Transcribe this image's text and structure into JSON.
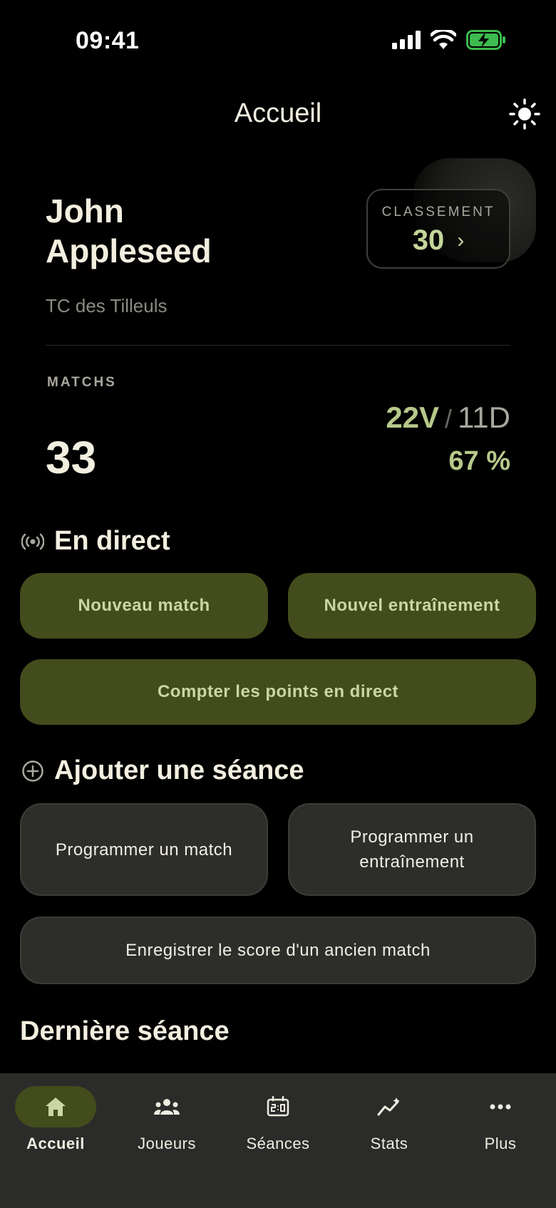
{
  "status_bar": {
    "time": "09:41"
  },
  "nav": {
    "title": "Accueil"
  },
  "profile": {
    "first_name": "John",
    "last_name": "Appleseed",
    "club": "TC des Tilleuls",
    "ranking_label": "CLASSEMENT",
    "ranking_value": "30",
    "ranking_chevron": "›"
  },
  "matches": {
    "label": "MATCHS",
    "count": "33",
    "wins": "22V",
    "separator": "/",
    "losses": "11D",
    "win_pct": "67 %"
  },
  "live": {
    "title": "En direct",
    "new_match": "Nouveau match",
    "new_training": "Nouvel entraînement",
    "live_score": "Compter les points en direct"
  },
  "add_session": {
    "title": "Ajouter une séance",
    "schedule_match": "Programmer un match",
    "schedule_training": "Programmer un entraînement",
    "record_old": "Enregistrer le score d'un ancien match"
  },
  "last_session": {
    "title": "Dernière séance"
  },
  "tabs": [
    {
      "label": "Accueil",
      "icon": "home-icon",
      "active": true
    },
    {
      "label": "Joueurs",
      "icon": "players-icon",
      "active": false
    },
    {
      "label": "Séances",
      "icon": "scoreboard-icon",
      "active": false
    },
    {
      "label": "Stats",
      "icon": "stats-icon",
      "active": false
    },
    {
      "label": "Plus",
      "icon": "more-icon",
      "active": false
    }
  ],
  "colors": {
    "accent_green": "#434c1c",
    "accent_text": "#b6c98a",
    "background": "#000000",
    "card": "#2d2e2a"
  }
}
